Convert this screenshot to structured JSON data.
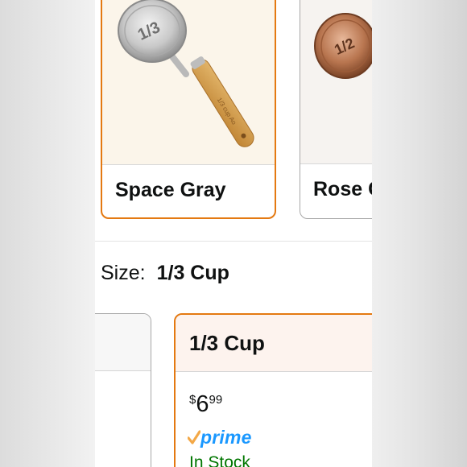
{
  "color_options": [
    {
      "label": "Space Gray",
      "selected": true,
      "image_icon": "measuring-cup-wood-handle"
    },
    {
      "label": "Rose Gold",
      "selected": false,
      "image_icon": "measuring-cup-copper"
    }
  ],
  "size": {
    "key_label": "Size:",
    "selected_value": "1/3 Cup"
  },
  "size_options": [
    {
      "title": "",
      "selected": false
    },
    {
      "title": "1/3 Cup",
      "selected": true,
      "price_symbol": "$",
      "price_whole": "6",
      "price_fraction": "99",
      "prime_label": "prime",
      "stock_status": "In Stock"
    }
  ],
  "colors": {
    "selected_border": "#e47911",
    "prime_blue": "#1a98ff",
    "prime_check": "#f3a847",
    "in_stock_green": "#007600"
  }
}
